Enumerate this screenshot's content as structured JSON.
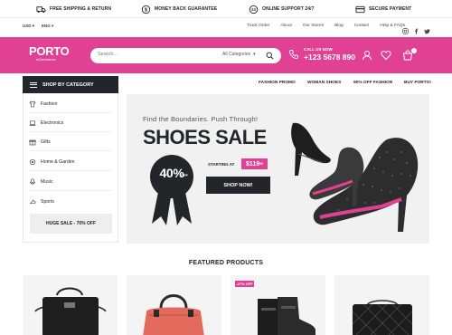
{
  "infobar": {
    "items": [
      {
        "icon": "truck-icon",
        "label": "FREE SHIPPING & RETURN"
      },
      {
        "icon": "money-icon",
        "label": "MONEY BACK GUARANTEE"
      },
      {
        "icon": "support-24-icon",
        "label": "ONLINE SUPPORT 24/7"
      },
      {
        "icon": "secure-payment-icon",
        "label": "SECURE PAYMENT"
      }
    ]
  },
  "utility": {
    "currency": "USD",
    "language": "ENG",
    "links": [
      "Track Order",
      "About",
      "Our Stores",
      "Blog",
      "Contact",
      "Help & FAQs"
    ]
  },
  "header": {
    "logo_main": "PORTO",
    "logo_sub": "eCommerce",
    "search_placeholder": "Search...",
    "search_category": "All Categories",
    "phone_label": "CALL US NOW",
    "phone_number": "+123 5678 890",
    "accent": "#e04193"
  },
  "nav": {
    "category_button": "SHOP BY CATEGORY",
    "links": [
      "FASHION PROMO",
      "WOMAN SHOES",
      "90% OFF FASHION",
      "BUY PORTO!"
    ]
  },
  "sidebar": {
    "items": [
      {
        "icon": "shirt-icon",
        "label": "Fashion"
      },
      {
        "icon": "laptop-icon",
        "label": "Electronics"
      },
      {
        "icon": "gift-icon",
        "label": "Gifts"
      },
      {
        "icon": "home-icon",
        "label": "Home & Garden"
      },
      {
        "icon": "music-icon",
        "label": "Music"
      },
      {
        "icon": "sports-icon",
        "label": "Sports"
      }
    ],
    "sale_button": "HUGE SALE - 70% OFF"
  },
  "hero": {
    "kicker": "Find the Boundaries. Push Through!",
    "title": "SHOES SALE",
    "discount": "40%",
    "discount_suffix": "OFF",
    "starting_label": "STARTING AT",
    "price": "$119",
    "price_cents": "99",
    "cta": "SHOP NOW!"
  },
  "featured": {
    "title": "FEATURED PRODUCTS",
    "products": [
      {
        "name": "black-leather-bag",
        "badge": ""
      },
      {
        "name": "red-handbag",
        "badge": ""
      },
      {
        "name": "black-boots",
        "badge": "-27% OFF"
      },
      {
        "name": "quilted-bag",
        "badge": ""
      }
    ]
  }
}
